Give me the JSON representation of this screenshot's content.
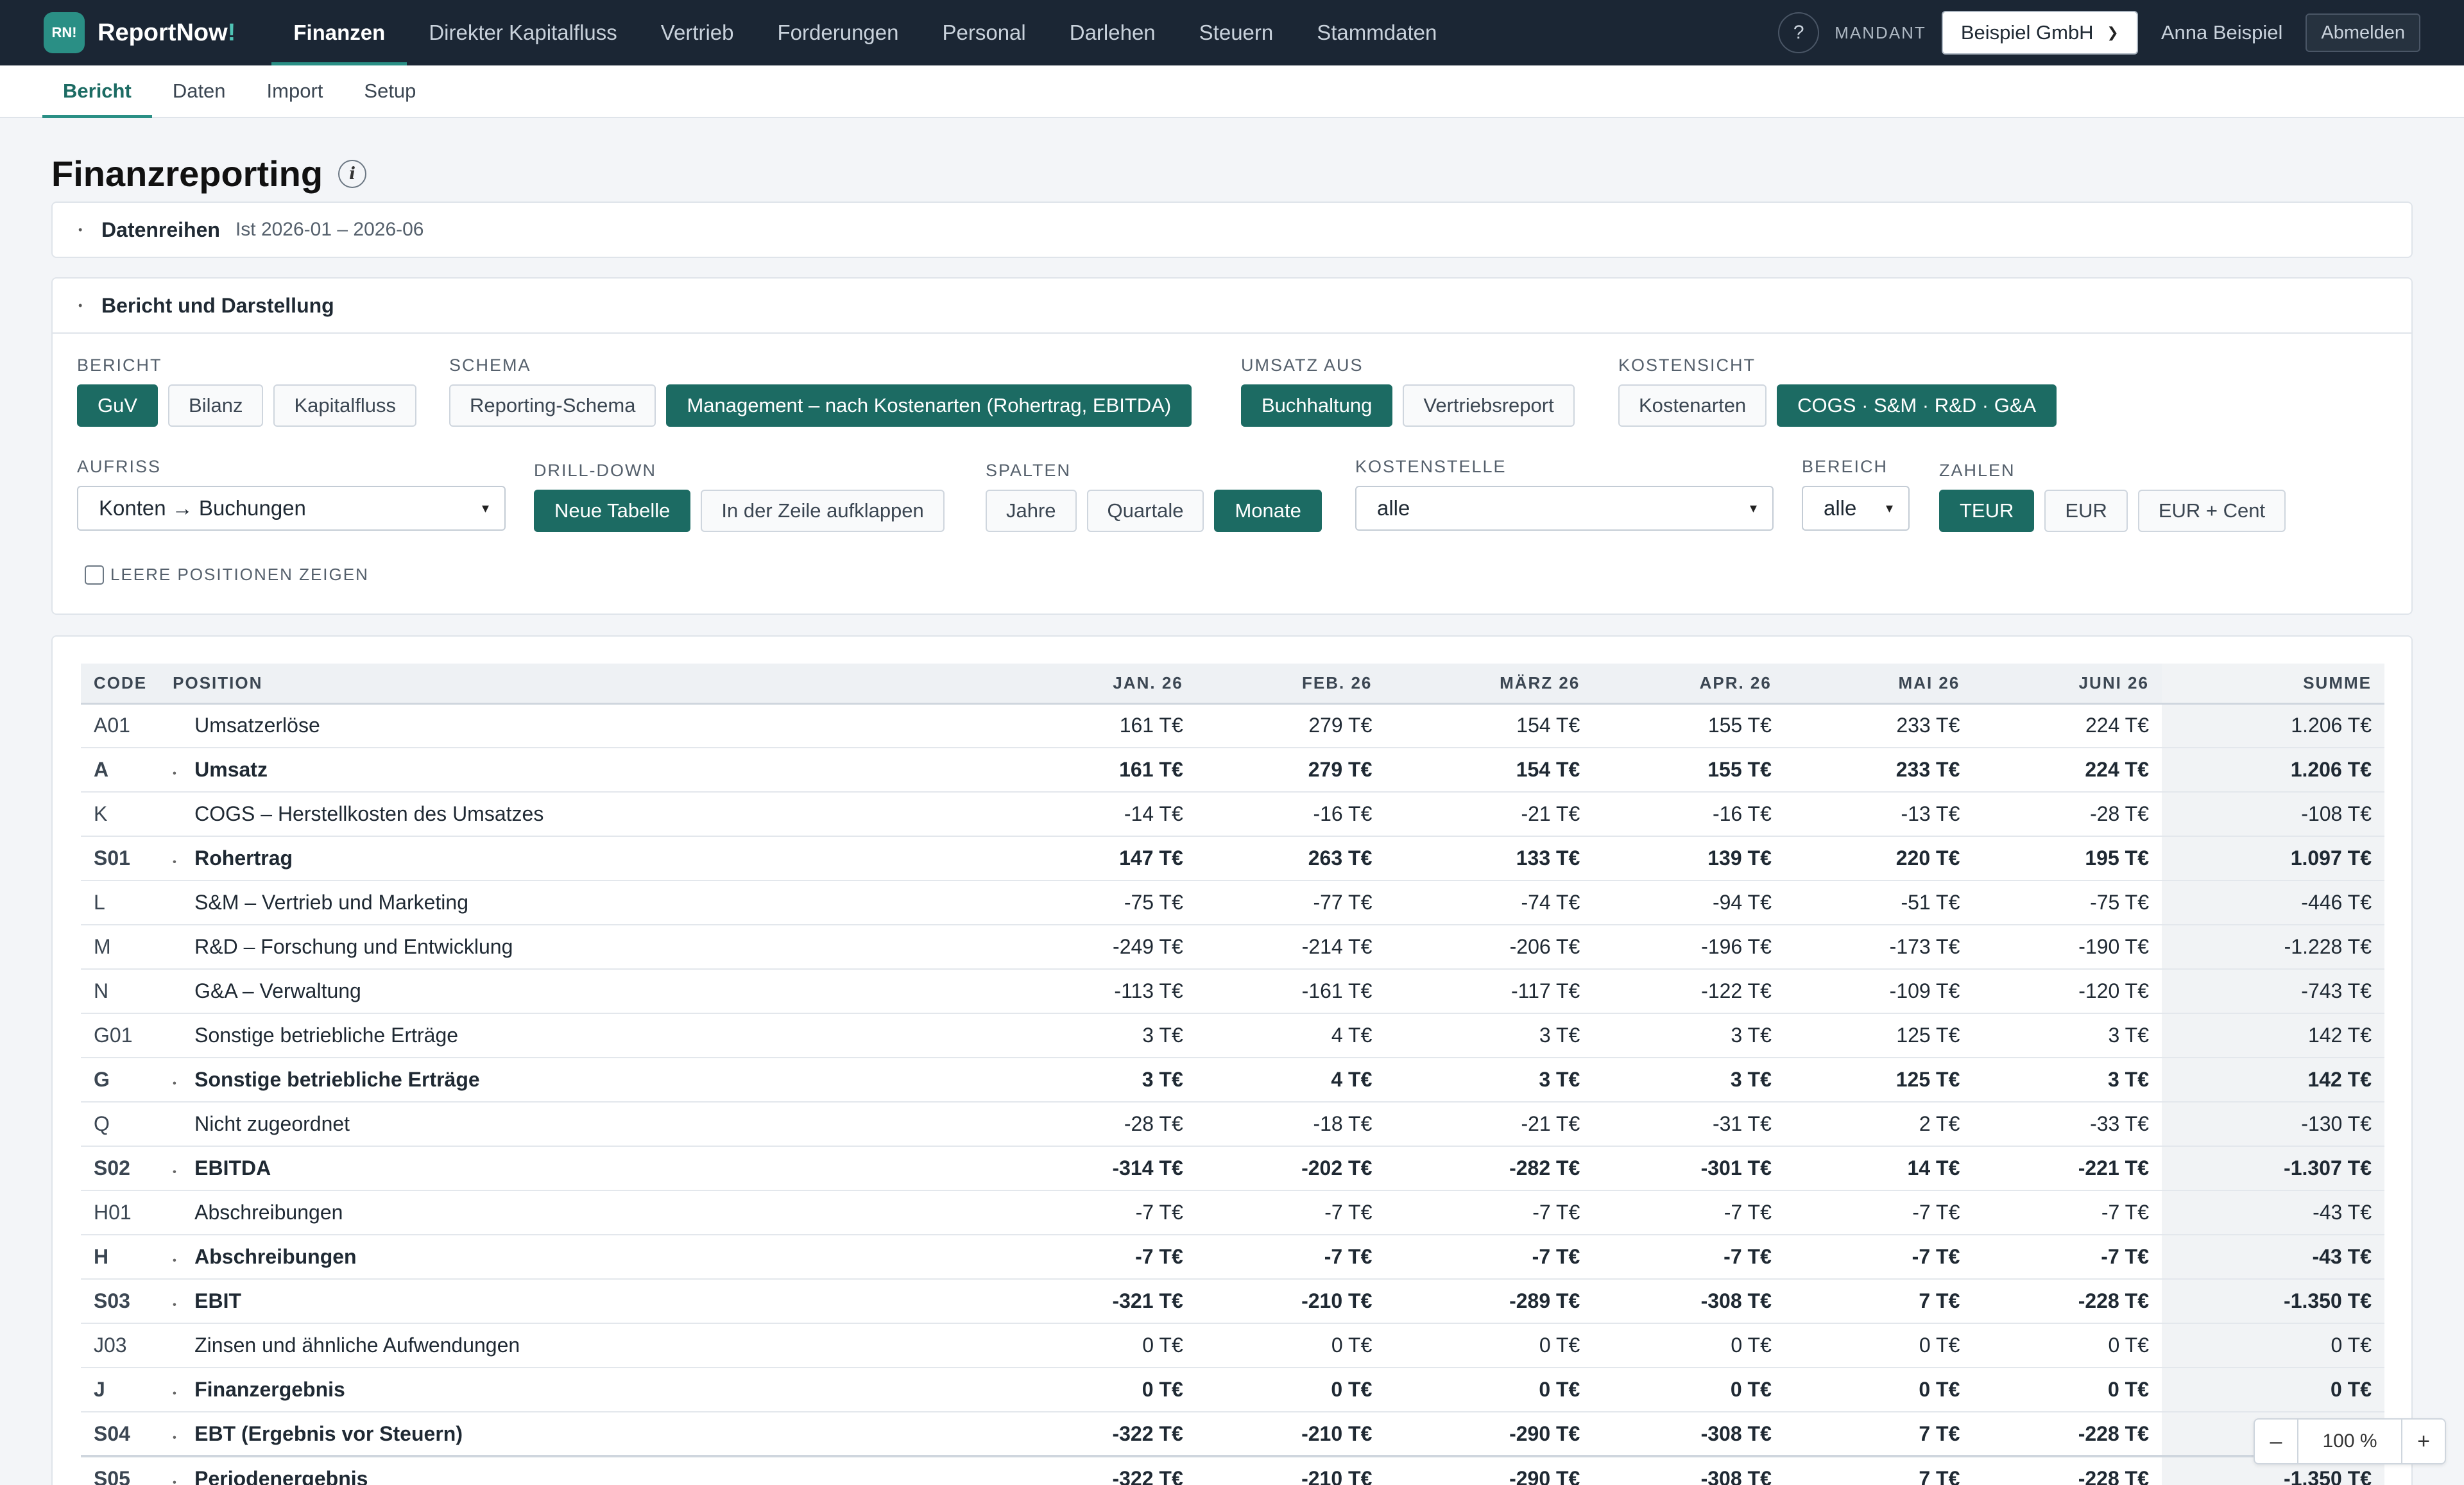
{
  "app": {
    "logo_badge": "RN!",
    "logo_name": "ReportNow",
    "logo_suffix": "!",
    "nav": [
      "Finanzen",
      "Direkter Kapitalfluss",
      "Vertrieb",
      "Forderungen",
      "Personal",
      "Darlehen",
      "Steuern",
      "Stammdaten"
    ],
    "help": "?",
    "mandant_label": "MANDANT",
    "mandant_value": "Beispiel GmbH",
    "username": "Anna Beispiel",
    "logout": "Abmelden"
  },
  "subnav": [
    "Bericht",
    "Daten",
    "Import",
    "Setup"
  ],
  "page_title": "Finanzreporting",
  "info_icon": "i",
  "datenreihen": {
    "title": "Datenreihen",
    "subtitle": "Ist 2026-01 – 2026-06"
  },
  "darstellung": {
    "title": "Bericht und Darstellung",
    "bericht": {
      "label": "BERICHT",
      "options": [
        "GuV",
        "Bilanz",
        "Kapitalfluss"
      ]
    },
    "schema": {
      "label": "SCHEMA",
      "options": [
        "Reporting-Schema",
        "Management – nach Kostenarten (Rohertrag, EBITDA)"
      ]
    },
    "umsatz": {
      "label": "UMSATZ AUS",
      "options": [
        "Buchhaltung",
        "Vertriebsreport"
      ]
    },
    "kostensicht": {
      "label": "KOSTENSICHT",
      "options": [
        "Kostenarten",
        "COGS · S&M · R&D · G&A"
      ]
    },
    "aufriss": {
      "label": "AUFRISS",
      "value": "Konten → Buchungen"
    },
    "drilldown": {
      "label": "DRILL-DOWN",
      "options": [
        "Neue Tabelle",
        "In der Zeile aufklappen"
      ]
    },
    "spalten": {
      "label": "SPALTEN",
      "options": [
        "Jahre",
        "Quartale",
        "Monate"
      ]
    },
    "kostenstelle": {
      "label": "KOSTENSTELLE",
      "value": "alle"
    },
    "bereich": {
      "label": "BEREICH",
      "value": "alle"
    },
    "zahlen": {
      "label": "ZAHLEN",
      "options": [
        "TEUR",
        "EUR",
        "EUR + Cent"
      ]
    },
    "leere": "LEERE POSITIONEN ZEIGEN"
  },
  "table": {
    "headers": [
      "CODE",
      "POSITION",
      "JAN. 26",
      "FEB. 26",
      "MÄRZ 26",
      "APR. 26",
      "MAI 26",
      "JUNI 26",
      "SUMME"
    ],
    "rows": [
      {
        "code": "A01",
        "pos": "Umsatzerlöse",
        "v": [
          "161 T€",
          "279 T€",
          "154 T€",
          "155 T€",
          "233 T€",
          "224 T€",
          "1.206 T€"
        ]
      },
      {
        "code": "A",
        "pos": "Umsatz",
        "v": [
          "161 T€",
          "279 T€",
          "154 T€",
          "155 T€",
          "233 T€",
          "224 T€",
          "1.206 T€"
        ]
      },
      {
        "code": "K",
        "pos": "COGS – Herstellkosten des Umsatzes",
        "v": [
          "-14 T€",
          "-16 T€",
          "-21 T€",
          "-16 T€",
          "-13 T€",
          "-28 T€",
          "-108 T€"
        ]
      },
      {
        "code": "S01",
        "pos": "Rohertrag",
        "v": [
          "147 T€",
          "263 T€",
          "133 T€",
          "139 T€",
          "220 T€",
          "195 T€",
          "1.097 T€"
        ]
      },
      {
        "code": "L",
        "pos": "S&M – Vertrieb und Marketing",
        "v": [
          "-75 T€",
          "-77 T€",
          "-74 T€",
          "-94 T€",
          "-51 T€",
          "-75 T€",
          "-446 T€"
        ]
      },
      {
        "code": "M",
        "pos": "R&D – Forschung und Entwicklung",
        "v": [
          "-249 T€",
          "-214 T€",
          "-206 T€",
          "-196 T€",
          "-173 T€",
          "-190 T€",
          "-1.228 T€"
        ]
      },
      {
        "code": "N",
        "pos": "G&A – Verwaltung",
        "v": [
          "-113 T€",
          "-161 T€",
          "-117 T€",
          "-122 T€",
          "-109 T€",
          "-120 T€",
          "-743 T€"
        ]
      },
      {
        "code": "G01",
        "pos": "Sonstige betriebliche Erträge",
        "v": [
          "3 T€",
          "4 T€",
          "3 T€",
          "3 T€",
          "125 T€",
          "3 T€",
          "142 T€"
        ]
      },
      {
        "code": "G",
        "pos": "Sonstige betriebliche Erträge",
        "v": [
          "3 T€",
          "4 T€",
          "3 T€",
          "3 T€",
          "125 T€",
          "3 T€",
          "142 T€"
        ]
      },
      {
        "code": "Q",
        "pos": "Nicht zugeordnet",
        "v": [
          "-28 T€",
          "-18 T€",
          "-21 T€",
          "-31 T€",
          "2 T€",
          "-33 T€",
          "-130 T€"
        ]
      },
      {
        "code": "S02",
        "pos": "EBITDA",
        "v": [
          "-314 T€",
          "-202 T€",
          "-282 T€",
          "-301 T€",
          "14 T€",
          "-221 T€",
          "-1.307 T€"
        ]
      },
      {
        "code": "H01",
        "pos": "Abschreibungen",
        "v": [
          "-7 T€",
          "-7 T€",
          "-7 T€",
          "-7 T€",
          "-7 T€",
          "-7 T€",
          "-43 T€"
        ]
      },
      {
        "code": "H",
        "pos": "Abschreibungen",
        "v": [
          "-7 T€",
          "-7 T€",
          "-7 T€",
          "-7 T€",
          "-7 T€",
          "-7 T€",
          "-43 T€"
        ]
      },
      {
        "code": "S03",
        "pos": "EBIT",
        "v": [
          "-321 T€",
          "-210 T€",
          "-289 T€",
          "-308 T€",
          "7 T€",
          "-228 T€",
          "-1.350 T€"
        ]
      },
      {
        "code": "J03",
        "pos": "Zinsen und ähnliche Aufwendungen",
        "v": [
          "0 T€",
          "0 T€",
          "0 T€",
          "0 T€",
          "0 T€",
          "0 T€",
          "0 T€"
        ]
      },
      {
        "code": "J",
        "pos": "Finanzergebnis",
        "v": [
          "0 T€",
          "0 T€",
          "0 T€",
          "0 T€",
          "0 T€",
          "0 T€",
          "0 T€"
        ]
      },
      {
        "code": "S04",
        "pos": "EBT (Ergebnis vor Steuern)",
        "v": [
          "-322 T€",
          "-210 T€",
          "-290 T€",
          "-308 T€",
          "7 T€",
          "-228 T€",
          "-1.350 T€"
        ]
      },
      {
        "code": "S05",
        "pos": "Periodenergebnis",
        "v": [
          "-322 T€",
          "-210 T€",
          "-290 T€",
          "-308 T€",
          "7 T€",
          "-228 T€",
          "-1.350 T€"
        ]
      }
    ]
  },
  "zoom": {
    "minus": "–",
    "value": "100 %",
    "plus": "+"
  }
}
